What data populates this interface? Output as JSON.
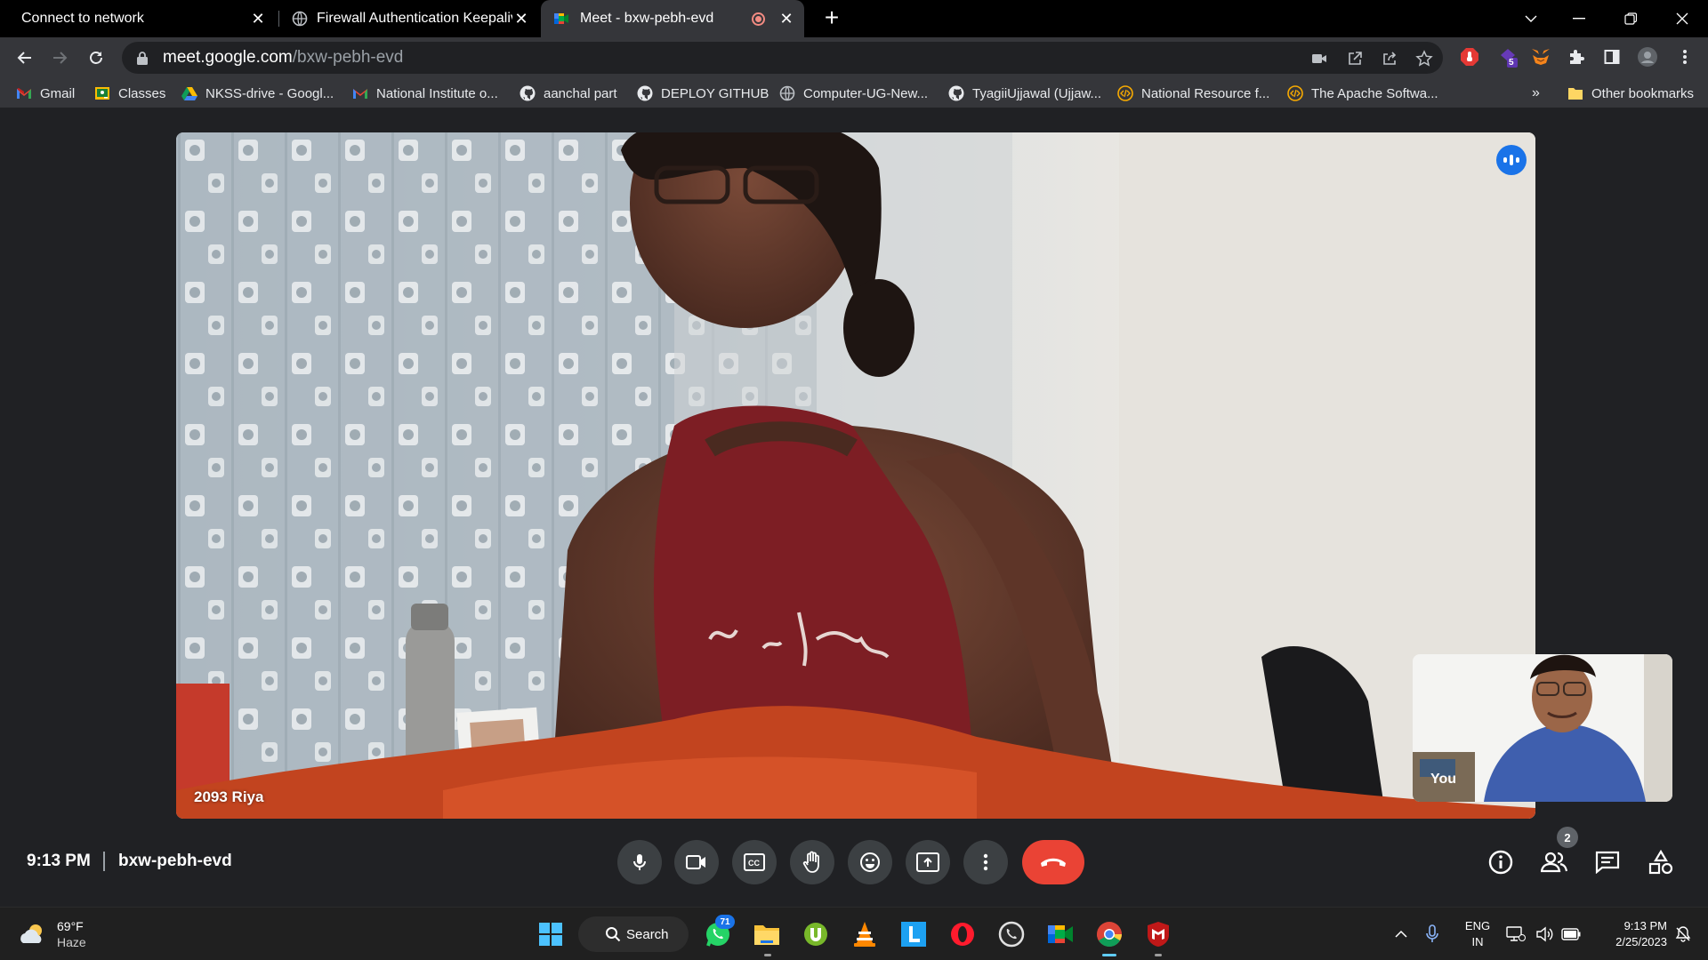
{
  "browser": {
    "tabs": [
      {
        "title": "Connect to network",
        "favicon": "none"
      },
      {
        "title": "Firewall Authentication Keepalive",
        "favicon": "globe-icon"
      },
      {
        "title": "Meet - bxw-pebh-evd",
        "favicon": "meet-icon",
        "active": true,
        "recording": true
      }
    ],
    "new_tab": "+",
    "window_controls": {
      "dropdown": "⌄",
      "minimize": "—",
      "restore": "❐",
      "close": "✕"
    },
    "address": {
      "host": "meet.google.com",
      "path": "/bxw-pebh-evd"
    },
    "extensions": {
      "badge": "5"
    },
    "bookmarks": [
      {
        "label": "Gmail",
        "icon": "gmail-icon"
      },
      {
        "label": "Classes",
        "icon": "classroom-icon"
      },
      {
        "label": "NKSS-drive - Googl...",
        "icon": "drive-icon"
      },
      {
        "label": "National Institute o...",
        "icon": "gmail-icon"
      },
      {
        "label": "aanchal part",
        "icon": "github-icon"
      },
      {
        "label": "DEPLOY GITHUB",
        "icon": "github-icon"
      },
      {
        "label": "Computer-UG-New...",
        "icon": "globe-icon"
      },
      {
        "label": "TyagiiUjjawal (Ujjaw...",
        "icon": "github-icon"
      },
      {
        "label": "National Resource f...",
        "icon": "code-icon"
      },
      {
        "label": "The Apache Softwa...",
        "icon": "code-icon"
      }
    ],
    "bookmarks_overflow": "»",
    "other_bookmarks": "Other bookmarks"
  },
  "meet": {
    "main_participant": "2093 Riya",
    "self_label": "You",
    "time": "9:13 PM",
    "meeting_code": "bxw-pebh-evd",
    "participant_count": "2",
    "controls": [
      "mic-icon",
      "camera-icon",
      "captions-icon",
      "raise-hand-icon",
      "emoji-icon",
      "present-icon",
      "more-options-icon",
      "hang-up-icon"
    ],
    "side_controls": [
      "info-icon",
      "people-icon",
      "chat-icon",
      "activities-icon"
    ]
  },
  "taskbar": {
    "weather": {
      "temp": "69°F",
      "condition": "Haze"
    },
    "search_label": "Search",
    "whatsapp_badge": "71",
    "language": {
      "line1": "ENG",
      "line2": "IN"
    },
    "clock": {
      "time": "9:13 PM",
      "date": "2/25/2023"
    }
  },
  "colors": {
    "meet_bg": "#202124",
    "hangup": "#ea4335",
    "speaking": "#1a73e8",
    "control_bg": "#3c4043"
  }
}
